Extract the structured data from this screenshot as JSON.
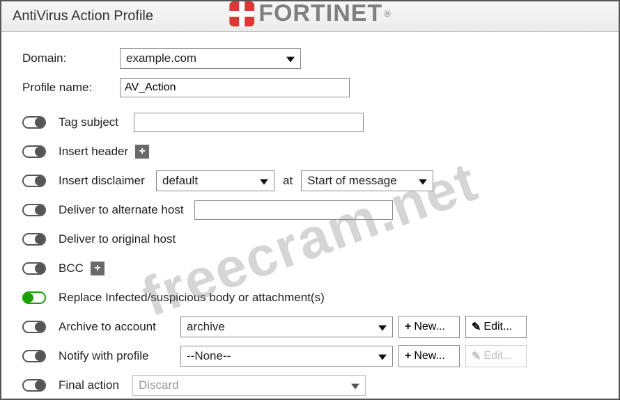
{
  "brand": {
    "name": "FORTINET",
    "registered": "®"
  },
  "watermark": "freecram.net",
  "header": {
    "title": "AntiVirus Action Profile"
  },
  "domain_row": {
    "label": "Domain:",
    "value": "example.com"
  },
  "profile_row": {
    "label": "Profile name:",
    "value": "AV_Action"
  },
  "toggles": {
    "tag_subject": {
      "label": "Tag subject",
      "on": false,
      "value": ""
    },
    "insert_header": {
      "label": "Insert header",
      "on": false
    },
    "insert_disclaimer": {
      "label": "Insert disclaimer",
      "on": false,
      "template": "default",
      "at_label": "at",
      "position": "Start of message"
    },
    "alt_host": {
      "label": "Deliver to alternate host",
      "on": false,
      "value": ""
    },
    "orig_host": {
      "label": "Deliver to original host",
      "on": false
    },
    "bcc": {
      "label": "BCC",
      "on": false
    },
    "replace": {
      "label": "Replace Infected/suspicious body or attachment(s)",
      "on": true
    },
    "archive": {
      "label": "Archive to account",
      "on": false,
      "account": "archive"
    },
    "notify": {
      "label": "Notify with profile",
      "on": false,
      "profile": "--None--"
    },
    "final_action": {
      "label": "Final action",
      "on": false,
      "value": "Discard"
    }
  },
  "buttons": {
    "new": "New...",
    "edit": "Edit..."
  },
  "icons": {
    "plus": "+",
    "edit_glyph": "✎"
  }
}
